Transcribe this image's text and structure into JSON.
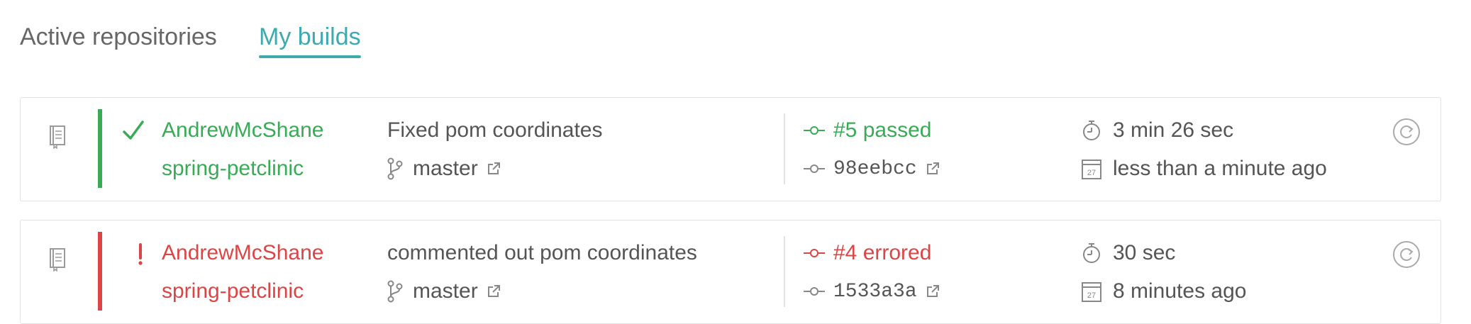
{
  "tabs": [
    {
      "label": "Active repositories",
      "active": false
    },
    {
      "label": "My builds",
      "active": true
    }
  ],
  "colors": {
    "accent": "#3eaaaf",
    "passed": "#39aa56",
    "errored": "#db4545"
  },
  "builds": [
    {
      "status": "passed",
      "status_icon": "check-icon",
      "owner": "AndrewMcShane",
      "repo": "spring-petclinic",
      "message": "Fixed pom coordinates",
      "branch": "master",
      "build": "#5 passed",
      "commit": "98eebcc",
      "duration": "3 min 26 sec",
      "finished": "less than a minute ago",
      "calendar_day": "27"
    },
    {
      "status": "errored",
      "status_icon": "exclamation-icon",
      "owner": "AndrewMcShane",
      "repo": "spring-petclinic",
      "message": "commented out pom coordinates",
      "branch": "master",
      "build": "#4 errored",
      "commit": "1533a3a",
      "duration": "30 sec",
      "finished": "8 minutes ago",
      "calendar_day": "27"
    }
  ]
}
